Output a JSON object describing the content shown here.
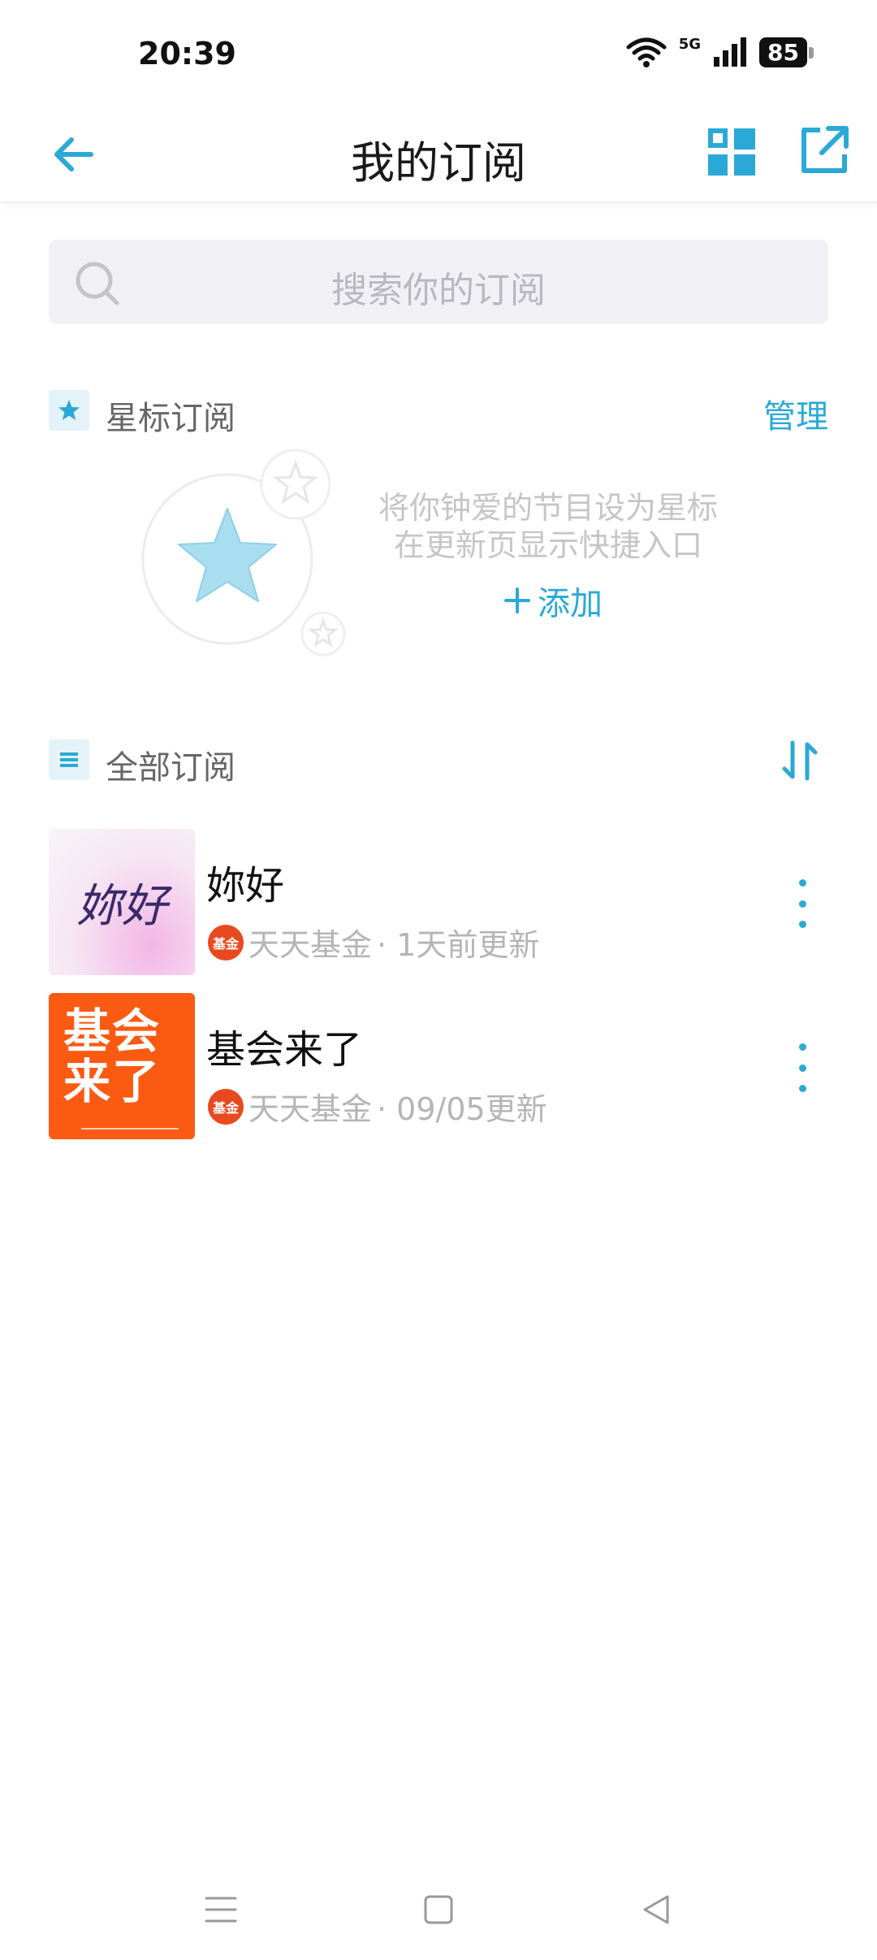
{
  "status_bar": {
    "time": "20:39",
    "network": "5G",
    "battery": "85"
  },
  "header": {
    "title": "我的订阅",
    "back_icon": "arrow-left-icon",
    "grid_icon": "grid-icon",
    "share_icon": "share-external-icon"
  },
  "search": {
    "placeholder": "搜索你的订阅"
  },
  "starred": {
    "title": "星标订阅",
    "action": "管理",
    "hint_line1": "将你钟爱的节目设为星标",
    "hint_line2": "在更新页显示快捷入口",
    "add_label": "添加"
  },
  "all_subs": {
    "title": "全部订阅",
    "sort_icon": "sort-icon",
    "items": [
      {
        "title": "妳好",
        "cover_text": "妳好",
        "source": "天天基金",
        "source_logo_text": "基金",
        "updated": "· 1天前更新"
      },
      {
        "title": "基会来了",
        "cover_text": "基会来了",
        "source": "天天基金",
        "source_logo_text": "基金",
        "updated": "· 09/05更新"
      }
    ]
  },
  "colors": {
    "accent": "#2ba9d6",
    "text_primary": "#111111",
    "text_muted": "#b5b5b5"
  }
}
